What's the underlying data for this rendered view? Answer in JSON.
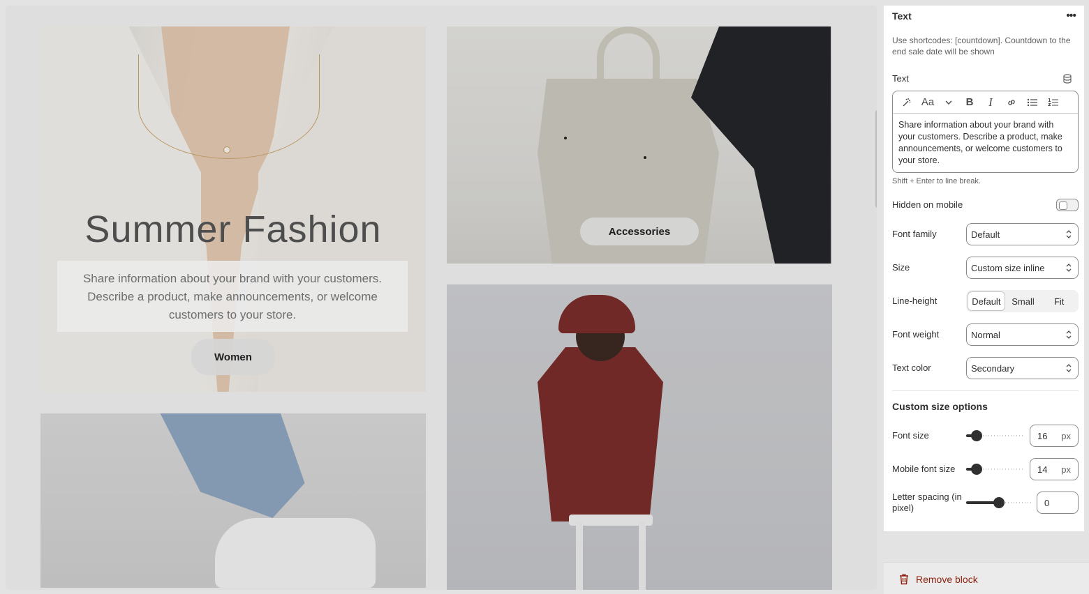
{
  "preview": {
    "women_tile": {
      "heading": "Summer Fashion",
      "text": "Share information about your brand with your customers. Describe a product, make announcements, or welcome customers to your store.",
      "button": "Women"
    },
    "accessories_tile": {
      "button": "Accessories"
    }
  },
  "panel": {
    "title": "Text",
    "more_icon": "more-horizontal-icon",
    "info": "Use shortcodes: [countdown]. Countdown to the end sale date will be shown",
    "text_label": "Text",
    "rte": {
      "toolbar": [
        "magic-icon",
        "font-size-icon",
        "chevron-down-icon",
        "bold-icon",
        "italic-icon",
        "link-icon",
        "bullet-list-icon",
        "numbered-list-icon"
      ],
      "font_glyph": "Aa",
      "bold_glyph": "B",
      "italic_glyph": "I",
      "content": "Share information about your brand with your customers. Describe a product, make announcements, or welcome customers to your store."
    },
    "hint": "Shift + Enter to line break.",
    "hidden_on_mobile": {
      "label": "Hidden on mobile",
      "value": false
    },
    "font_family": {
      "label": "Font family",
      "value": "Default"
    },
    "size": {
      "label": "Size",
      "value": "Custom size inline"
    },
    "line_height": {
      "label": "Line-height",
      "options": [
        "Default",
        "Small",
        "Fit"
      ],
      "selected": "Default"
    },
    "font_weight": {
      "label": "Font weight",
      "value": "Normal"
    },
    "text_color": {
      "label": "Text color",
      "value": "Secondary"
    },
    "custom_section": "Custom size options",
    "font_size": {
      "label": "Font size",
      "value": "16",
      "unit": "px",
      "level": 0.1
    },
    "mobile_font_size": {
      "label": "Mobile font size",
      "value": "14",
      "unit": "px",
      "level": 0.1
    },
    "letter_spacing": {
      "label": "Letter spacing (in pixel)",
      "value": "0",
      "level": 0.5
    }
  },
  "remove_block": {
    "label": "Remove block",
    "icon": "trash-icon",
    "color": "#8e1f0b"
  }
}
